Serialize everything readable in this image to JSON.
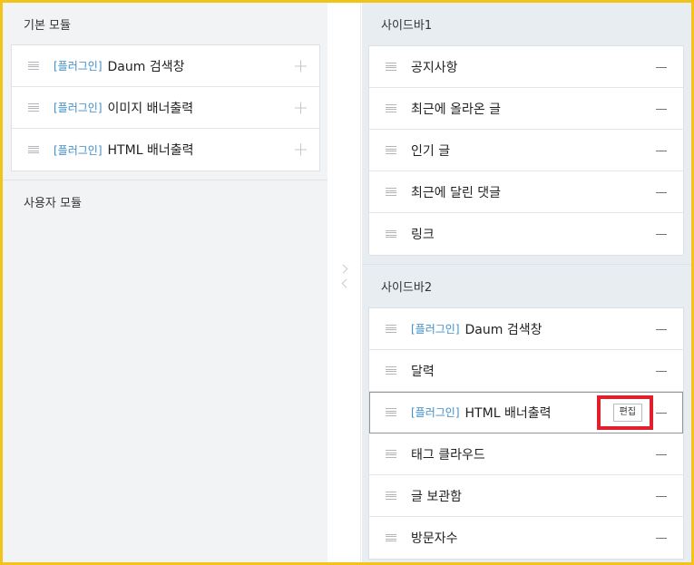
{
  "left": {
    "basic_title": "기본 모듈",
    "basic_items": [
      {
        "tag": "[플러그인]",
        "label": "Daum 검색창"
      },
      {
        "tag": "[플러그인]",
        "label": "이미지 배너출력"
      },
      {
        "tag": "[플러그인]",
        "label": "HTML 배너출력"
      }
    ],
    "user_title": "사용자 모듈"
  },
  "sidebar1": {
    "title": "사이드바1",
    "items": [
      {
        "label": "공지사항"
      },
      {
        "label": "최근에 올라온 글"
      },
      {
        "label": "인기 글"
      },
      {
        "label": "최근에 달린 댓글"
      },
      {
        "label": "링크"
      }
    ]
  },
  "sidebar2": {
    "title": "사이드바2",
    "items": [
      {
        "tag": "[플러그인]",
        "label": "Daum 검색창"
      },
      {
        "label": "달력"
      },
      {
        "tag": "[플러그인]",
        "label": "HTML 배너출력",
        "edit_label": "편집"
      },
      {
        "label": "태그 클라우드"
      },
      {
        "label": "글 보관함"
      },
      {
        "label": "방문자수"
      }
    ]
  },
  "colors": {
    "plugin_tag": "#3d8ec9",
    "frame": "#f2c41a",
    "highlight": "#e0202a"
  }
}
